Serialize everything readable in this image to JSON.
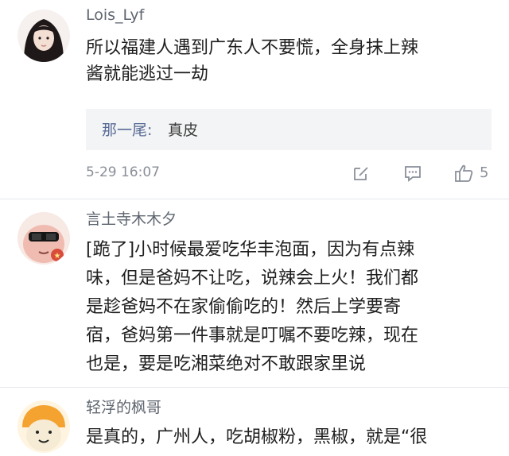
{
  "comments": [
    {
      "username": "Lois_Lyf",
      "text_line1": "所以福建人遇到广东人不要慌，全身抹上辣",
      "text_line2": "酱就能逃过一劫",
      "reply": {
        "name": "那一尾:",
        "text": "真皮"
      },
      "date": "5-29 16:07",
      "likes": "5"
    },
    {
      "username": "言土寺木木夕",
      "lines": [
        "[跪了]小时候最爱吃华丰泡面，因为有点辣",
        "味，但是爸妈不让吃，说辣会上火！我们都",
        "是趁爸妈不在家偷偷吃的！然后上学要寄",
        "宿，爸妈第一件事就是叮嘱不要吃辣，现在",
        "也是，要是吃湘菜绝对不敢跟家里说"
      ]
    },
    {
      "username": "轻浮的枫哥",
      "text_line1": "是真的，广州人，吃胡椒粉，黑椒，就是“很"
    }
  ],
  "icons": {
    "edit": "edit-icon",
    "comment": "comment-icon",
    "like": "thumbs-up-icon"
  }
}
